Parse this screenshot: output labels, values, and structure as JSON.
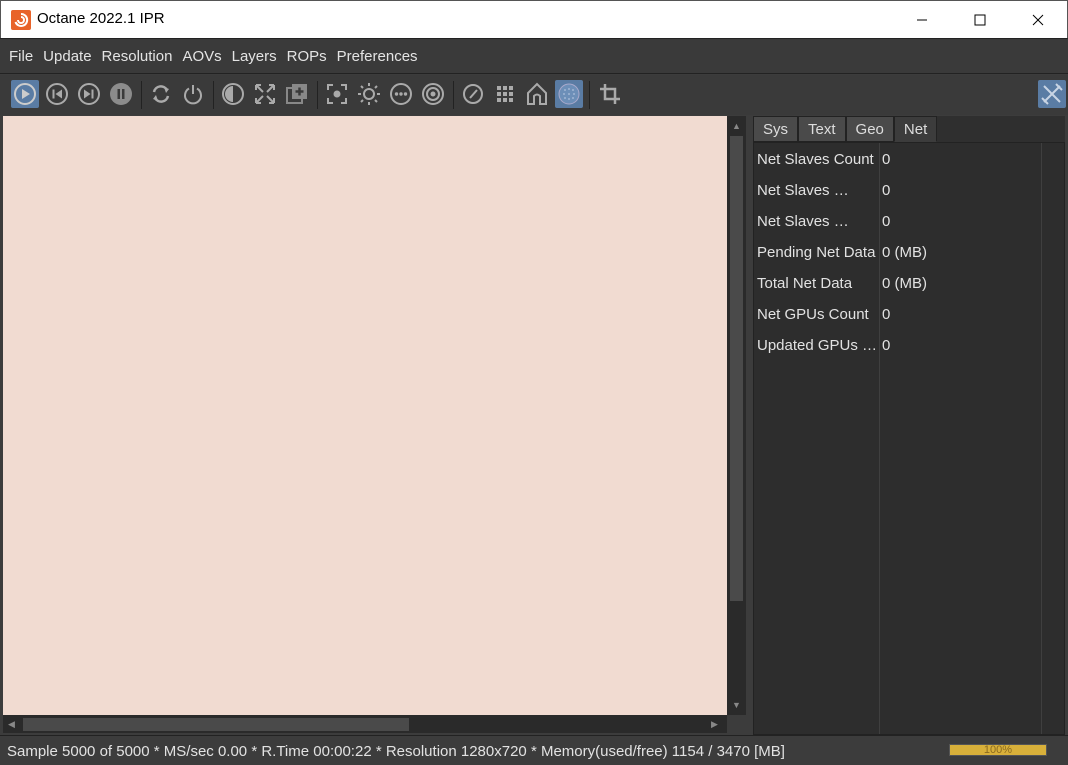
{
  "window": {
    "title": "Octane 2022.1 IPR",
    "app_icon": "houdini-logo-icon",
    "controls": [
      "minimize-icon",
      "maximize-icon",
      "close-icon"
    ]
  },
  "menu": [
    "File",
    "Update",
    "Resolution",
    "AOVs",
    "Layers",
    "ROPs",
    "Preferences"
  ],
  "toolbar": {
    "buttons": [
      {
        "icon": "play-icon",
        "active": true
      },
      {
        "icon": "skip-back-icon"
      },
      {
        "icon": "skip-forward-icon"
      },
      {
        "icon": "pause-icon"
      },
      {
        "icon": "refresh-icon"
      },
      {
        "icon": "power-icon"
      },
      {
        "icon": "contrast-icon"
      },
      {
        "icon": "expand-icon"
      },
      {
        "icon": "add-layer-icon"
      },
      {
        "icon": "focus-icon"
      },
      {
        "icon": "sun-icon"
      },
      {
        "icon": "more-icon"
      },
      {
        "icon": "target-icon"
      },
      {
        "icon": "gauge-icon"
      },
      {
        "icon": "grid-icon"
      },
      {
        "icon": "home-icon"
      },
      {
        "icon": "sphere-icon",
        "active": true
      },
      {
        "icon": "crop-icon"
      }
    ],
    "right_icon": "tools-icon"
  },
  "viewport": {
    "background": "#f1dbd1"
  },
  "panel": {
    "tabs": [
      "Sys",
      "Text",
      "Geo",
      "Net"
    ],
    "active_tab": "Net",
    "rows": [
      {
        "key": "Net Slaves Count",
        "value": "0"
      },
      {
        "key": "Net Slaves …",
        "value": "0"
      },
      {
        "key": "Net Slaves …",
        "value": "0"
      },
      {
        "key": "Pending Net Data",
        "value": "0 (MB)"
      },
      {
        "key": "Total Net Data",
        "value": "0 (MB)"
      },
      {
        "key": "Net GPUs Count",
        "value": "0"
      },
      {
        "key": "Updated GPUs …",
        "value": "0"
      }
    ]
  },
  "status": {
    "text": "Sample 5000 of 5000 * MS/sec 0.00 * R.Time 00:00:22 * Resolution 1280x720 * Memory(used/free) 1154 / 3470 [MB]",
    "progress_label": "100%",
    "progress_fraction": 1.0,
    "progress_color": "#d8b03a"
  }
}
